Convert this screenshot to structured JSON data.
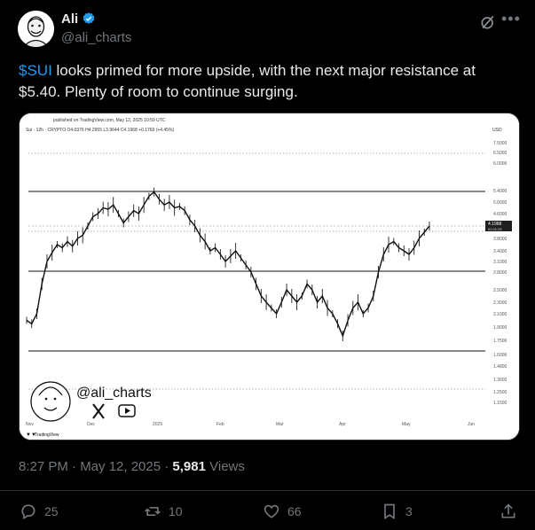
{
  "author": {
    "name": "Ali",
    "handle": "@ali_charts",
    "verified": true
  },
  "tweet": {
    "cashtag": "$SUI",
    "text": " looks primed for more upside, with the next major resistance at $5.40. Plenty of room to continue surging."
  },
  "meta": {
    "time": "8:27 PM · May 12, 2025 · ",
    "views": "5,981",
    "views_label": " Views"
  },
  "actions": {
    "replies": "25",
    "reposts": "10",
    "likes": "66",
    "bookmarks": "3"
  },
  "icons": [
    "verified-badge-icon",
    "grok-icon",
    "more-icon",
    "reply-icon",
    "repost-icon",
    "like-icon",
    "bookmark-icon",
    "share-icon",
    "x-logo-icon",
    "youtube-icon",
    "tradingview-icon"
  ],
  "colors": {
    "accent": "#1d9bf0",
    "background": "#000000"
  },
  "chart_data": {
    "type": "line",
    "published": "published on TradingView.com, May 12, 2025 10:59 UTC",
    "header": "Sui · 12h · CRYPTO O4.0376 H4.2955 L3.9644 C4.1968 +0.1769 (+4.45%)",
    "currency": "USD",
    "watermark": "@ali_charts",
    "brand": "TradingView",
    "last_price": "4.1968",
    "last_price_time": "01:01:25",
    "x_ticks": [
      "Nov",
      "Dec",
      "2025",
      "Feb",
      "Mar",
      "Apr",
      "May",
      "Jun"
    ],
    "y_ticks": [
      "7.5000",
      "6.5000",
      "6.0000",
      "5.4000",
      "5.0000",
      "4.6000",
      "3.8000",
      "3.4000",
      "3.1000",
      "2.8000",
      "2.5000",
      "2.3000",
      "2.1000",
      "1.9000",
      "1.7500",
      "1.6000",
      "1.4800",
      "1.3600",
      "1.2500",
      "1.1500"
    ],
    "horizontal_levels": [
      5.4,
      3.1,
      1.75
    ],
    "dotted_levels": [
      7.0,
      4.2,
      1.36
    ],
    "series": [
      {
        "values": [
          2.0,
          1.95,
          2.1,
          2.6,
          3.1,
          3.35,
          3.6,
          3.5,
          3.7,
          3.55,
          3.8,
          3.9,
          4.2,
          4.5,
          4.6,
          4.8,
          4.75,
          4.9,
          4.6,
          4.3,
          4.5,
          4.7,
          4.6,
          4.9,
          5.2,
          5.35,
          5.1,
          4.9,
          5.0,
          4.8,
          4.85,
          4.7,
          4.4,
          4.2,
          3.9,
          3.7,
          3.4,
          3.5,
          3.3,
          3.1,
          3.25,
          3.4,
          3.2,
          3.0,
          2.8,
          2.6,
          2.4,
          2.3,
          2.2,
          2.1,
          2.3,
          2.5,
          2.4,
          2.3,
          2.4,
          2.6,
          2.5,
          2.3,
          2.4,
          2.2,
          2.1,
          1.95,
          1.8,
          2.0,
          2.2,
          2.3,
          2.1,
          2.2,
          2.4,
          2.8,
          3.3,
          3.6,
          3.7,
          3.5,
          3.4,
          3.3,
          3.5,
          3.8,
          4.0,
          4.2
        ]
      }
    ]
  }
}
